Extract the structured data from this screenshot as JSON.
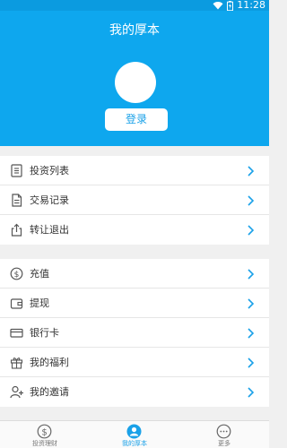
{
  "status_bar": {
    "time": "11:28"
  },
  "header": {
    "title": "我的厚本",
    "login_label": "登录"
  },
  "groups": [
    {
      "items": [
        {
          "label": "投资列表",
          "icon": "list-icon"
        },
        {
          "label": "交易记录",
          "icon": "document-icon"
        },
        {
          "label": "转让退出",
          "icon": "export-icon"
        }
      ]
    },
    {
      "items": [
        {
          "label": "充值",
          "icon": "dollar-coin-icon"
        },
        {
          "label": "提现",
          "icon": "wallet-icon"
        },
        {
          "label": "银行卡",
          "icon": "bank-card-icon"
        },
        {
          "label": "我的福利",
          "icon": "gift-icon"
        },
        {
          "label": "我的邀请",
          "icon": "add-user-icon"
        }
      ]
    }
  ],
  "tabbar": [
    {
      "label": "投资理财",
      "icon": "money-circle-icon",
      "active": false
    },
    {
      "label": "我的厚本",
      "icon": "user-circle-icon",
      "active": true
    },
    {
      "label": "更多",
      "icon": "more-icon",
      "active": false
    }
  ],
  "colors": {
    "accent": "#0ea7ee",
    "status_bar": "#0b9be0",
    "arrow": "#1aa1e8"
  }
}
